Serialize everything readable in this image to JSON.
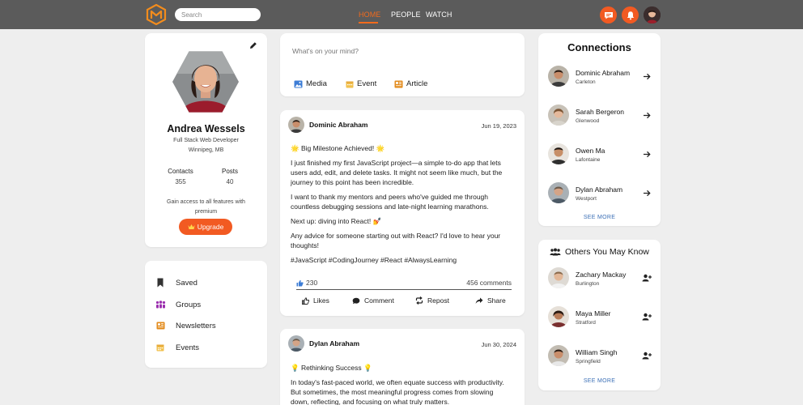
{
  "header": {
    "search_placeholder": "Search",
    "nav": [
      {
        "label": "HOME",
        "active": true
      },
      {
        "label": "PEOPLE",
        "active": false
      },
      {
        "label": "WATCH",
        "active": false
      }
    ],
    "accent_color": "#f25a22",
    "header_bg": "#5b5b5b",
    "icons": [
      "logo-icon",
      "message-icon",
      "bell-icon",
      "user-avatar"
    ]
  },
  "profile": {
    "name": "Andrea Wessels",
    "title": "Full Stack Web Developer",
    "location": "Winnipeg, MB",
    "stats": [
      {
        "label": "Contacts",
        "value": "355"
      },
      {
        "label": "Posts",
        "value": "40"
      }
    ],
    "upgrade_text": "Gain access to all features with premium",
    "upgrade_label": "Upgrade"
  },
  "sidebar": {
    "items": [
      {
        "label": "Saved",
        "icon": "bookmark-icon"
      },
      {
        "label": "Groups",
        "icon": "groups-icon"
      },
      {
        "label": "Newsletters",
        "icon": "newsletter-icon"
      },
      {
        "label": "Events",
        "icon": "calendar-icon"
      }
    ]
  },
  "compose": {
    "placeholder": "What's on your mind?",
    "buttons": [
      {
        "label": "Media",
        "icon": "image-icon"
      },
      {
        "label": "Event",
        "icon": "calendar-icon"
      },
      {
        "label": "Article",
        "icon": "article-icon"
      }
    ]
  },
  "posts": [
    {
      "author": "Dominic Abraham",
      "date": "Jun 19, 2023",
      "paragraphs": [
        "🌟 Big Milestone Achieved! 🌟",
        "I just finished my first JavaScript project—a simple to-do app that lets users add, edit, and delete tasks. It might not seem like much, but the journey to this point has been incredible.",
        "I want to thank my mentors and peers who've guided me through countless debugging sessions and late-night learning marathons.",
        "Next up: diving into React! 💅",
        "Any advice for someone starting out with React? I'd love to hear your thoughts!",
        "#JavaScript #CodingJourney #React #AlwaysLearning"
      ],
      "likes": "230",
      "comments": "456 comments",
      "actions": [
        "Likes",
        "Comment",
        "Repost",
        "Share"
      ]
    },
    {
      "author": "Dylan Abraham",
      "date": "Jun 30, 2024",
      "paragraphs": [
        "💡 Rethinking Success 💡",
        "In today's fast-paced world, we often equate success with productivity. But sometimes, the most meaningful progress comes from slowing down, reflecting, and focusing on what truly matters."
      ]
    }
  ],
  "connections": {
    "title": "Connections",
    "people": [
      {
        "name": "Dominic Abraham",
        "location": "Carleton"
      },
      {
        "name": "Sarah Bergeron",
        "location": "Glenwood"
      },
      {
        "name": "Owen Ma",
        "location": "Lafontaine"
      },
      {
        "name": "Dylan Abraham",
        "location": "Westport"
      }
    ],
    "see_more": "SEE MORE"
  },
  "suggestions": {
    "title": "Others You May Know",
    "people": [
      {
        "name": "Zachary Mackay",
        "location": "Burlington"
      },
      {
        "name": "Maya Miller",
        "location": "Stratford"
      },
      {
        "name": "William Singh",
        "location": "Springfield"
      }
    ],
    "see_more": "SEE MORE"
  }
}
